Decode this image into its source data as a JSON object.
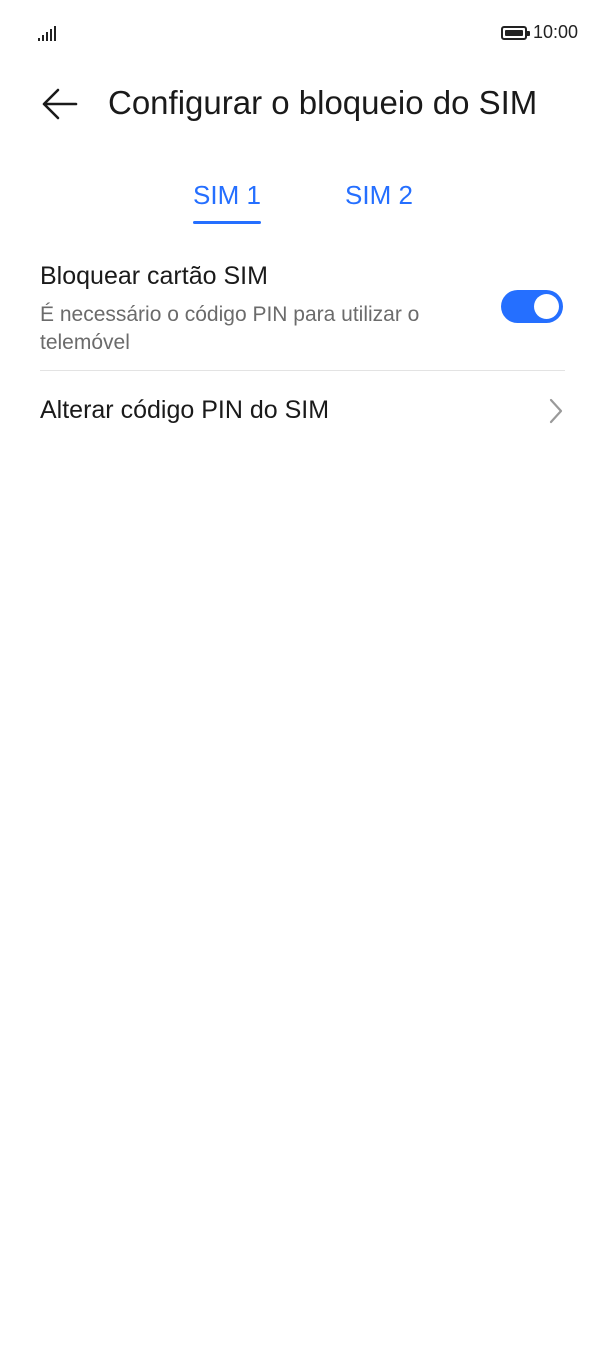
{
  "status_bar": {
    "time": "10:00",
    "signal_icon": "signal-bars-icon",
    "battery_icon": "battery-full-icon"
  },
  "header": {
    "title": "Configurar o bloqueio do SIM",
    "back_icon": "arrow-left-icon"
  },
  "tabs": [
    {
      "label": "SIM 1",
      "selected": true
    },
    {
      "label": "SIM 2",
      "selected": false
    }
  ],
  "settings": {
    "sim_lock": {
      "title": "Bloquear cartão SIM",
      "subtitle": "É necessário o código PIN para utilizar o telemóvel",
      "enabled": true
    },
    "change_pin": {
      "title": "Alterar código PIN do SIM",
      "chevron_icon": "chevron-right-icon"
    }
  },
  "colors": {
    "accent": "#256fff",
    "text_primary": "#1a1a1a",
    "text_secondary": "#6b6b6b",
    "divider": "#e3e3e3",
    "background": "#ffffff"
  }
}
